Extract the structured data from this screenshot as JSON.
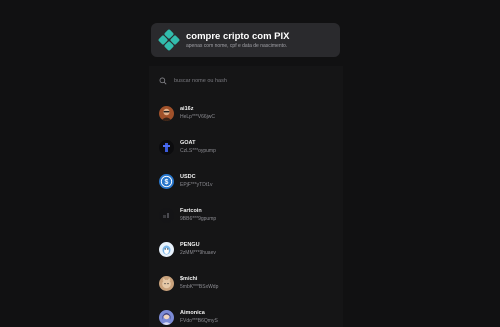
{
  "banner": {
    "title": "compre cripto com PIX",
    "subtitle": "apenas com nome, cpf e data de nascimento.",
    "icon": "pix-icon",
    "accent": "#32bcad"
  },
  "search": {
    "placeholder": "buscar nome ou hash",
    "value": "",
    "icon": "search-icon"
  },
  "tokens": [
    {
      "name": "ai16z",
      "address": "HeLp***V66jwC"
    },
    {
      "name": "GOAT",
      "address": "CzLS***oypump"
    },
    {
      "name": "USDC",
      "address": "EPjF***yTDt1v"
    },
    {
      "name": "Fartcoin",
      "address": "9BB6***9gpump"
    },
    {
      "name": "PENGU",
      "address": "2zMM***9huaev"
    },
    {
      "name": "$michi",
      "address": "5mbK***BSxWdp"
    },
    {
      "name": "Aimonica",
      "address": "FVdo***B6QmyS"
    }
  ]
}
